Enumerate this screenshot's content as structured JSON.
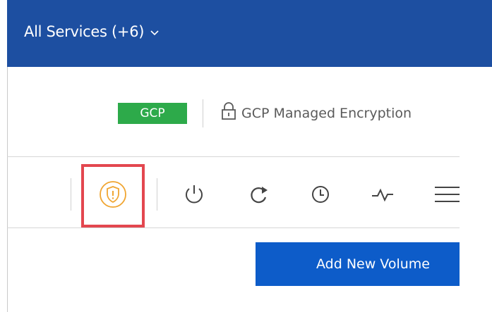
{
  "header": {
    "services_label": "All Services (+6)",
    "chevron_icon": "chevron-down-icon"
  },
  "provider": {
    "badge": "GCP",
    "badge_color": "#2daa4a",
    "encryption_label": "GCP Managed Encryption",
    "encryption_icon": "lock-icon"
  },
  "toolbar": {
    "icons": [
      "shield-alert-icon",
      "power-icon",
      "refresh-icon",
      "clock-icon",
      "activity-icon",
      "menu-icon"
    ],
    "highlighted_icon": "shield-alert-icon",
    "highlight_color": "#e3474f",
    "shield_color": "#f0a531"
  },
  "actions": {
    "add_volume_label": "Add New Volume",
    "add_volume_color": "#0d5cc9"
  },
  "colors": {
    "topbar": "#1d4fa1"
  }
}
